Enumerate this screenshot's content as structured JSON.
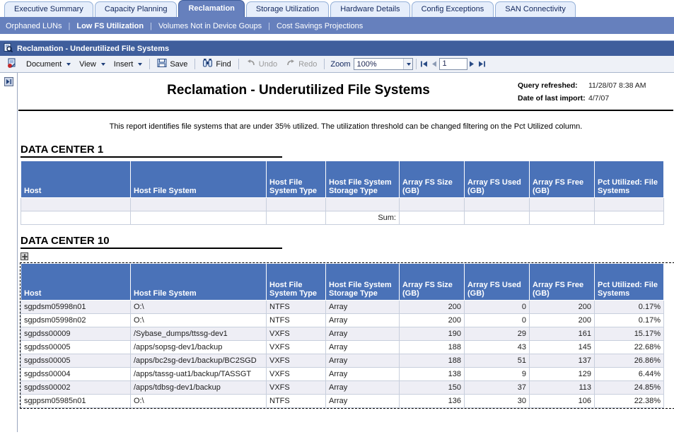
{
  "tabs": [
    {
      "label": "Executive Summary",
      "active": false
    },
    {
      "label": "Capacity Planning",
      "active": false
    },
    {
      "label": "Reclamation",
      "active": true
    },
    {
      "label": "Storage Utilization",
      "active": false
    },
    {
      "label": "Hardware Details",
      "active": false
    },
    {
      "label": "Config Exceptions",
      "active": false
    },
    {
      "label": "SAN Connectivity",
      "active": false
    }
  ],
  "subnav": [
    {
      "label": "Orphaned LUNs",
      "active": false
    },
    {
      "label": "Low FS Utilization",
      "active": true
    },
    {
      "label": "Volumes Not in Device Goups",
      "active": false
    },
    {
      "label": "Cost Savings Projections",
      "active": false
    }
  ],
  "document": {
    "title": "Reclamation - Underutilized File Systems",
    "icon": "report-document-icon"
  },
  "toolbar": {
    "document_menu": "Document",
    "view_menu": "View",
    "insert_menu": "Insert",
    "save_label": "Save",
    "find_label": "Find",
    "undo_label": "Undo",
    "redo_label": "Redo",
    "zoom_label": "Zoom",
    "zoom_value": "100%",
    "page_value": "1"
  },
  "report": {
    "title": "Reclamation - Underutilized File Systems",
    "meta": [
      {
        "label": "Query refreshed:",
        "value": "11/28/07 8:38 AM"
      },
      {
        "label": "Date of last import:",
        "value": "4/7/07"
      }
    ],
    "description": "This report identifies file systems that are under 35% utilized.  The utilization threshold can be changed filtering on the Pct Utilized column.",
    "columns": [
      "Host",
      "Host File System",
      "Host File System Type",
      "Host File System Storage Type",
      "Array FS Size (GB)",
      "Array FS Used (GB)",
      "Array FS Free (GB)",
      "Pct Utilized: File Systems"
    ],
    "sections": [
      {
        "heading": "DATA CENTER 1",
        "selected": false,
        "rows": [
          [
            "",
            "",
            "",
            "",
            "",
            "",
            "",
            ""
          ]
        ],
        "sum_label": "Sum:"
      },
      {
        "heading": "DATA CENTER 10",
        "selected": true,
        "rows": [
          [
            "sgpdsm05998n01",
            "O:\\",
            "NTFS",
            "Array",
            "200",
            "0",
            "200",
            "0.17%"
          ],
          [
            "sgpdsm05998n02",
            "O:\\",
            "NTFS",
            "Array",
            "200",
            "0",
            "200",
            "0.17%"
          ],
          [
            "sgpdss00009",
            "/Sybase_dumps/ttssg-dev1",
            "VXFS",
            "Array",
            "190",
            "29",
            "161",
            "15.17%"
          ],
          [
            "sgpdss00005",
            "/apps/sopsg-dev1/backup",
            "VXFS",
            "Array",
            "188",
            "43",
            "145",
            "22.68%"
          ],
          [
            "sgpdss00005",
            "/apps/bc2sg-dev1/backup/BC2SGD",
            "VXFS",
            "Array",
            "188",
            "51",
            "137",
            "26.86%"
          ],
          [
            "sgpdss00004",
            "/apps/tassg-uat1/backup/TASSGT",
            "VXFS",
            "Array",
            "138",
            "9",
            "129",
            "6.44%"
          ],
          [
            "sgpdss00002",
            "/apps/tdbsg-dev1/backup",
            "VXFS",
            "Array",
            "150",
            "37",
            "113",
            "24.85%"
          ],
          [
            "sgppsm05985n01",
            "O:\\",
            "NTFS",
            "Array",
            "136",
            "30",
            "106",
            "22.38%"
          ]
        ]
      }
    ]
  },
  "colors": {
    "nav_blue": "#6680bd",
    "title_blue": "#3f5e9c",
    "header_blue": "#4a72b8",
    "alt_row": "#eeeef5"
  }
}
